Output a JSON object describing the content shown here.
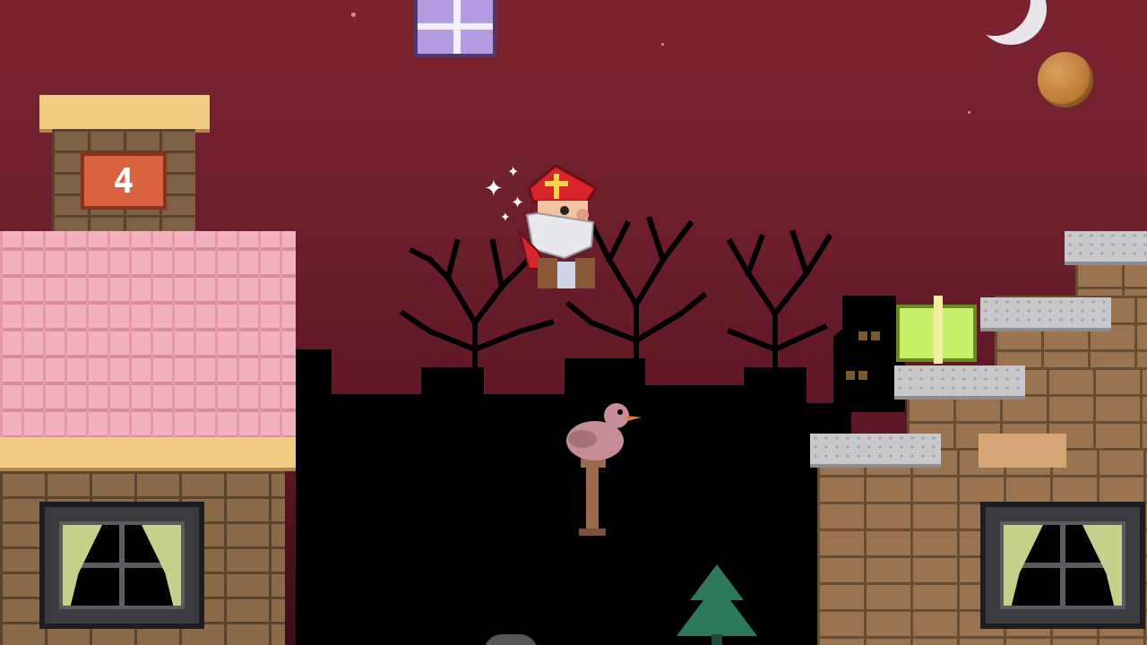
{
  "game": {
    "house_number": "4"
  },
  "scene": {
    "sky_color": "#6a1d2a",
    "objects": [
      {
        "name": "purple-gift",
        "color": "#b59be2"
      },
      {
        "name": "green-gift",
        "color": "#c8f06a"
      },
      {
        "name": "moon"
      },
      {
        "name": "pepernoot-cookie"
      },
      {
        "name": "sinterklaas-player"
      },
      {
        "name": "bird-on-post"
      },
      {
        "name": "christmas-tree"
      }
    ]
  }
}
